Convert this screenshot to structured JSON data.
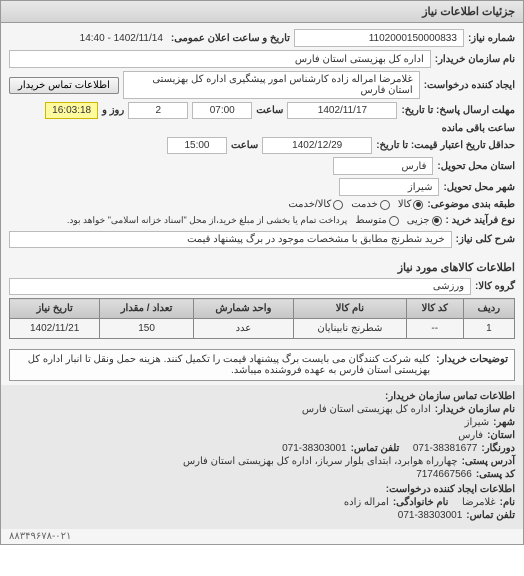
{
  "panel_title": "جزئیات اطلاعات نیاز",
  "need_no_label": "شماره نیاز:",
  "need_no": "1102000150000833",
  "announce_label": "تاریخ و ساعت اعلان عمومی:",
  "announce": "1402/11/14 - 14:40",
  "buyer_name_label": "نام سازمان خریدار:",
  "buyer_name": "اداره کل بهزیستی استان فارس",
  "requester_label": "ایجاد کننده درخواست:",
  "requester": "غلامرضا امراله زاده کارشناس امور پیشگیری اداره کل بهزیستی استان فارس",
  "contact_btn": "اطلاعات تماس خریدار",
  "deadline_label": "مهلت ارسال پاسخ: تا تاریخ:",
  "deadline_date": "1402/11/17",
  "time_label": "ساعت",
  "deadline_time": "07:00",
  "days_remain": "2",
  "days_suffix": "روز و",
  "countdown": "16:03:18",
  "countdown_suffix": "ساعت باقی مانده",
  "validity_label": "حداقل تاریخ اعتبار قیمت: تا تاریخ:",
  "validity_date": "1402/12/29",
  "validity_time": "15:00",
  "province_label": "استان محل تحویل:",
  "province": "فارس",
  "city_label": "شهر محل تحویل:",
  "city": "شیراز",
  "group_label": "طبقه بندی موضوعی:",
  "g_goods": "کالا",
  "g_service": "خدمت",
  "g_both": "کالا/خدمت",
  "buy_mode_label": "نوع فرآیند خرید :",
  "m_small": "جزیی",
  "m_medium": "متوسط",
  "m_note": "پرداخت تمام یا بخشی از مبلغ خرید،از محل \"اسناد خزانه اسلامی\" خواهد بود.",
  "desc_label": "شرح کلی نیاز:",
  "desc": "خرید شطرنج مطابق با مشخصات موجود در برگ پیشنهاد قیمت",
  "goods_title": "اطلاعات کالاهای مورد نیاز",
  "group_name_label": "گروه کالا:",
  "group_name": "ورزشی",
  "th_row": "ردیف",
  "th_code": "کد کالا",
  "th_name": "نام کالا",
  "th_unit": "واحد شمارش",
  "th_qty": "تعداد / مقدار",
  "th_date": "تاریخ نیاز",
  "rows": [
    {
      "no": "1",
      "code": "--",
      "name": "شطرنج نابینایان",
      "unit": "عدد",
      "qty": "150",
      "date": "1402/11/21"
    }
  ],
  "note_label": "توضیحات خریدار:",
  "note_text": "کلیه شرکت کنندگان می بایست برگ پیشنهاد قیمت را تکمیل کنند. هزینه حمل ونقل تا انبار اداره کل بهزیستی استان فارس به عهده فروشنده میباشد.",
  "contact_title": "اطلاعات تماس سازمان خریدار:",
  "c_org_k": "نام سازمان خریدار:",
  "c_org_v": "اداره کل بهزیستی استان فارس",
  "c_city_k": "شهر:",
  "c_city_v": "شیراز",
  "c_prov_k": "استان:",
  "c_prov_v": "فارس",
  "c_fax_k": "دورنگار:",
  "c_fax_v": "071-38381677",
  "c_tel_k": "تلفن تماس:",
  "c_tel_v": "071-38303001",
  "c_addr_k": "آدرس پستی:",
  "c_addr_v": "چهارراه هوابرد، ابتدای بلوار سرباز، اداره کل بهزیستی استان فارس",
  "c_post_k": "کد پستی:",
  "c_post_v": "7174667566",
  "req_contact_title": "اطلاعات ایجاد کننده درخواست:",
  "r_name_k": "نام:",
  "r_name_v": "غلامرضا",
  "r_family_k": "نام خانوادگی:",
  "r_family_v": "امراله زاده",
  "r_tel_k": "تلفن تماس:",
  "r_tel_v": "071-38303001",
  "footer_tel": "۸۸۳۴۹۶۷۸-۰۲۱"
}
